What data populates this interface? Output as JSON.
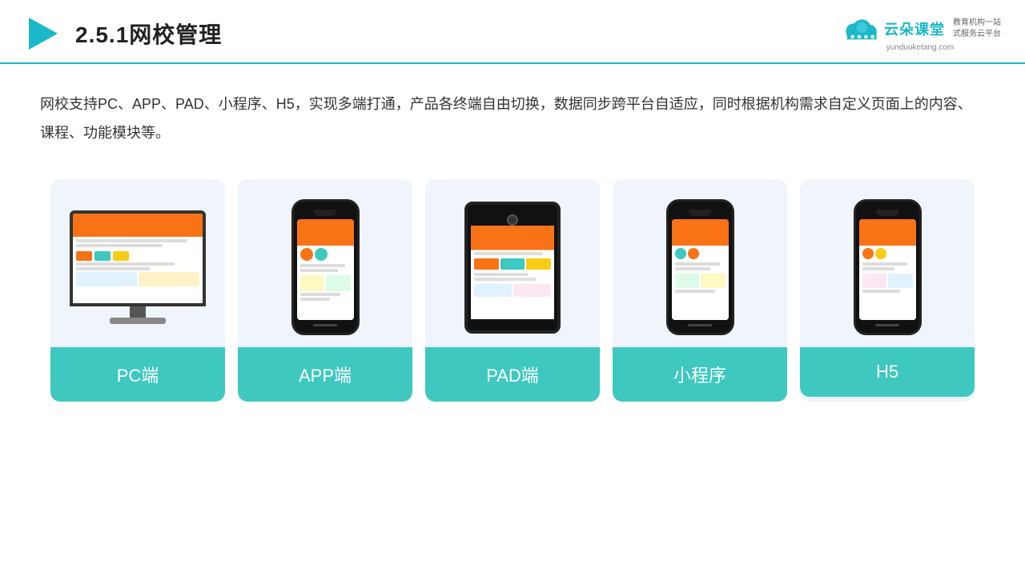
{
  "header": {
    "title": "2.5.1网校管理",
    "logo_name": "云朵课堂",
    "logo_url": "yunduoketang.com",
    "logo_slogan": "教育机构一站\n式服务云平台"
  },
  "description": {
    "text": "网校支持PC、APP、PAD、小程序、H5，实现多端打通，产品各终端自由切换，数据同步跨平台自适应，同时根据机构需求自定义页面上的内容、课程、功能模块等。"
  },
  "cards": [
    {
      "id": "pc",
      "label": "PC端"
    },
    {
      "id": "app",
      "label": "APP端"
    },
    {
      "id": "pad",
      "label": "PAD端"
    },
    {
      "id": "miniprogram",
      "label": "小程序"
    },
    {
      "id": "h5",
      "label": "H5"
    }
  ],
  "colors": {
    "accent": "#3ec8c0",
    "header_border": "#1ab8c8",
    "bg_card": "#f0f4fb",
    "text_main": "#333333",
    "text_title": "#222222"
  }
}
